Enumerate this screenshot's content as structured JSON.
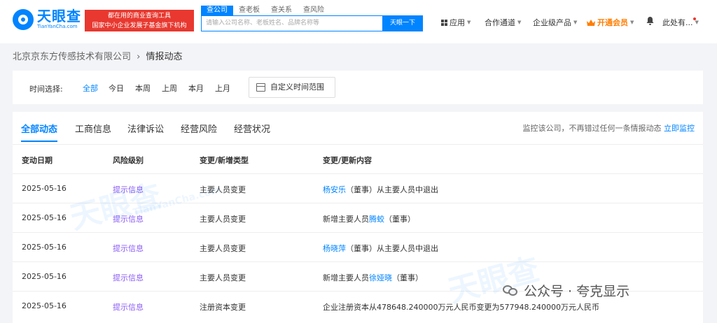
{
  "logo": {
    "name": "天眼查",
    "domain": "TianYanCha.com"
  },
  "slogan": {
    "line1": "都在用的商业查询工具",
    "line2": "国家中小企业发展子基金旗下机构"
  },
  "search": {
    "tabs": [
      "查公司",
      "查老板",
      "查关系",
      "查风险"
    ],
    "placeholder": "请输入公司名称、老板姓名、品牌名称等",
    "button": "天眼一下"
  },
  "nav": {
    "apps": "应用",
    "partner": "合作通道",
    "enterprise": "企业级产品",
    "vip": "开通会员",
    "user": "此处有..."
  },
  "breadcrumb": {
    "company": "北京京东方传感技术有限公司",
    "separator": "›",
    "current": "情报动态"
  },
  "filter": {
    "label": "时间选择:",
    "options": [
      "全部",
      "今日",
      "本周",
      "上周",
      "本月",
      "上月"
    ],
    "custom": "自定义时间范围"
  },
  "tabs": [
    "全部动态",
    "工商信息",
    "法律诉讼",
    "经营风险",
    "经营状况"
  ],
  "monitor": {
    "text": "监控该公司，不再错过任何一条情报动态",
    "link": "立即监控"
  },
  "table": {
    "headers": [
      "变动日期",
      "风险级别",
      "变更/新增类型",
      "变更/更新内容"
    ],
    "rows": [
      {
        "date": "2025-05-16",
        "risk": "提示信息",
        "type": "主要人员变更",
        "pre": "",
        "name": "杨安乐",
        "post": "（董事）从主要人员中退出"
      },
      {
        "date": "2025-05-16",
        "risk": "提示信息",
        "type": "主要人员变更",
        "pre": "新增主要人员",
        "name": "腾蛟",
        "post": "（董事）"
      },
      {
        "date": "2025-05-16",
        "risk": "提示信息",
        "type": "主要人员变更",
        "pre": "",
        "name": "杨晓萍",
        "post": "（董事）从主要人员中退出"
      },
      {
        "date": "2025-05-16",
        "risk": "提示信息",
        "type": "主要人员变更",
        "pre": "新增主要人员",
        "name": "徐娅晓",
        "post": "（董事）"
      },
      {
        "date": "2025-05-16",
        "risk": "提示信息",
        "type": "注册资本变更",
        "pre": "企业注册资本从478648.240000万元人民币变更为577948.240000万元人民币",
        "name": "",
        "post": ""
      }
    ]
  },
  "watermark": {
    "cn": "天眼查",
    "en": "TianYanCha.com"
  },
  "wechat": {
    "text": "公众号 · 夸克显示"
  },
  "colors": {
    "brand": "#0084ff",
    "risk": "#8b5cf6",
    "vip": "#ff7d00",
    "slogan_bg": "#e8382f"
  }
}
